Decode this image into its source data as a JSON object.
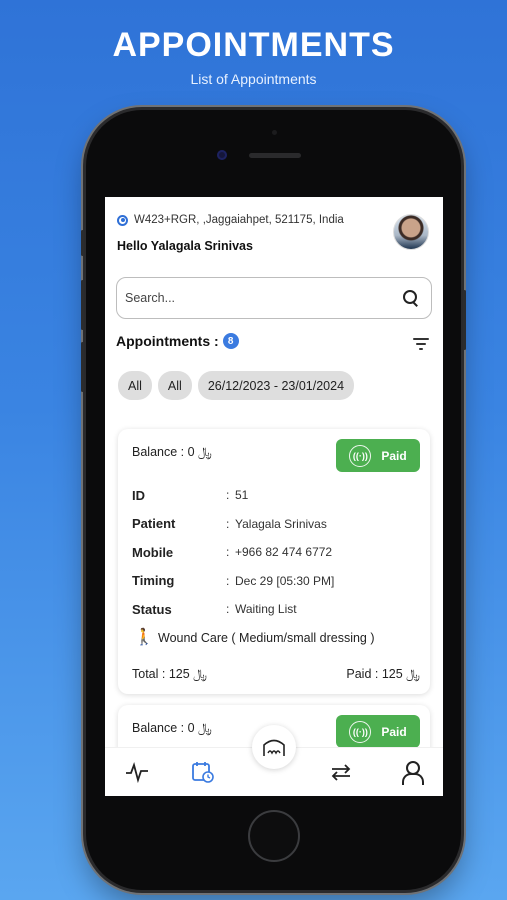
{
  "promo": {
    "title": "APPOINTMENTS",
    "subtitle": "List of Appointments"
  },
  "header": {
    "location": "W423+RGR, ,Jaggaiahpet, 521175, India",
    "greeting": "Hello Yalagala Srinivas",
    "location_icon": "location-pin-icon",
    "avatar_icon": "user-avatar"
  },
  "search": {
    "placeholder": "Search..."
  },
  "appointments": {
    "label": "Appointments :",
    "count": "8"
  },
  "filters": {
    "chips": [
      "All",
      "All",
      "26/12/2023 - 23/01/2024"
    ]
  },
  "cards": [
    {
      "balance": "Balance : ﷼ 0",
      "status_button": "Paid",
      "fields": [
        {
          "key": "ID",
          "value": "51"
        },
        {
          "key": "Patient",
          "value": "Yalagala Srinivas"
        },
        {
          "key": "Mobile",
          "value": "+966 82 474 6772"
        },
        {
          "key": "Timing",
          "value": "Dec 29 [05:30 PM]"
        },
        {
          "key": "Status",
          "value": "Waiting List"
        }
      ],
      "service": "Wound Care ( Medium/small dressing )",
      "total": "Total : ﷼ 125",
      "paid": "Paid : ﷼ 125"
    },
    {
      "balance": "Balance : ﷼ 0",
      "status_button": "Paid"
    }
  ],
  "colors": {
    "accent": "#3b7be0",
    "paid": "#4caf50",
    "background": "#3a84e2"
  }
}
